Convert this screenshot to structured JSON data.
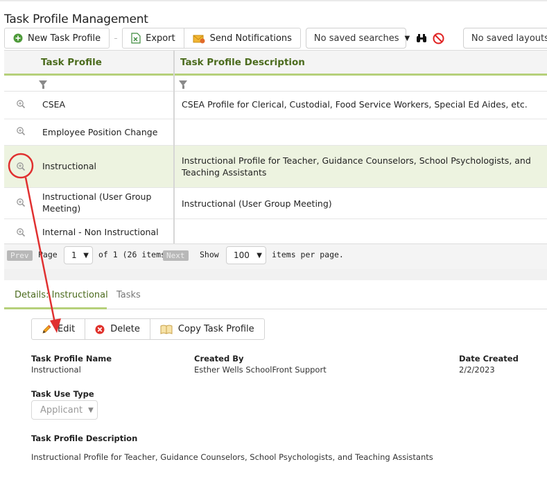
{
  "page": {
    "title": "Task Profile Management"
  },
  "toolbar": {
    "new_label": "New Task Profile",
    "export_label": "Export",
    "notify_label": "Send Notifications",
    "saved_searches": "No saved searches",
    "saved_layouts": "No saved layouts"
  },
  "grid": {
    "col_profile": "Task Profile",
    "col_description": "Task Profile Description",
    "rows": [
      {
        "name": "CSEA",
        "description": "CSEA Profile for Clerical, Custodial, Food Service Workers, Special Ed Aides, etc."
      },
      {
        "name": "Employee Position Change",
        "description": ""
      },
      {
        "name": "Instructional",
        "description": "Instructional Profile for Teacher, Guidance Counselors, School Psychologists, and Teaching Assistants"
      },
      {
        "name": "Instructional (User Group Meeting)",
        "description": "Instructional (User Group Meeting)"
      },
      {
        "name": "Internal - Non Instructional",
        "description": ""
      }
    ]
  },
  "pager": {
    "prev": "Prev",
    "page_label": "Page",
    "page_value": "1",
    "of_text": "of 1 (26 items)",
    "next": "Next",
    "show_label": "Show",
    "per_page": "100",
    "per_page_suffix": "items per page."
  },
  "tabs": {
    "details": "Details: Instructional",
    "tasks": "Tasks"
  },
  "details": {
    "edit": "Edit",
    "delete": "Delete",
    "copy": "Copy Task Profile",
    "name_label": "Task Profile Name",
    "name_value": "Instructional",
    "created_by_label": "Created By",
    "created_by_value": "Esther Wells SchoolFront Support",
    "date_label": "Date Created",
    "date_value": "2/2/2023",
    "use_type_label": "Task Use Type",
    "use_type_value": "Applicant",
    "desc_label": "Task Profile Description",
    "desc_value": "Instructional Profile for Teacher, Guidance Counselors, School Psychologists, and Teaching Assistants"
  },
  "colors": {
    "accent": "#4b6b1d",
    "highlight": "#e03030",
    "underline": "#b6d07a"
  }
}
